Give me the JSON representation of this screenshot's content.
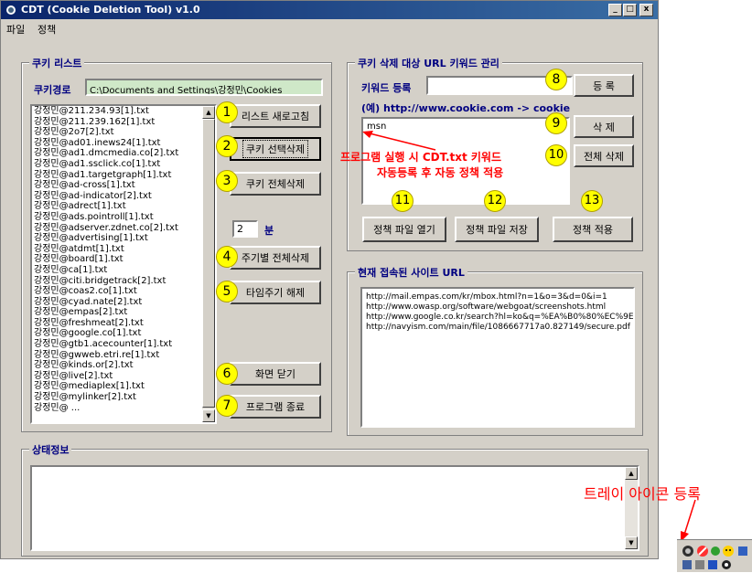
{
  "window": {
    "title": "CDT (Cookie Deletion Tool) v1.0",
    "minimize": "_",
    "maximize": "□",
    "close": "x"
  },
  "menu": [
    "파일",
    "정책"
  ],
  "cookie_list": {
    "group_label": "쿠키 리스트",
    "path_label": "쿠키경로",
    "path_value": "C:\\Documents and Settings\\강정민\\Cookies",
    "items": [
      "강정민@211.234.93[1].txt",
      "강정민@211.239.162[1].txt",
      "강정민@2o7[2].txt",
      "강정민@ad01.inews24[1].txt",
      "강정민@ad1.dmcmedia.co[2].txt",
      "강정민@ad1.ssclick.co[1].txt",
      "강정민@ad1.targetgraph[1].txt",
      "강정민@ad-cross[1].txt",
      "강정민@ad-indicator[2].txt",
      "강정민@adrect[1].txt",
      "강정민@ads.pointroll[1].txt",
      "강정민@adserver.zdnet.co[2].txt",
      "강정민@advertising[1].txt",
      "강정민@atdmt[1].txt",
      "강정민@board[1].txt",
      "강정민@ca[1].txt",
      "강정민@citi.bridgetrack[2].txt",
      "강정민@coas2.co[1].txt",
      "강정민@cyad.nate[2].txt",
      "강정민@empas[2].txt",
      "강정민@freshmeat[2].txt",
      "강정민@google.co[1].txt",
      "강정민@gtb1.acecounter[1].txt",
      "강정민@gwweb.etri.re[1].txt",
      "강정민@kinds.or[2].txt",
      "강정민@live[2].txt",
      "강정민@mediaplex[1].txt",
      "강정민@mylinker[2].txt",
      "강정민@ ..."
    ],
    "buttons": {
      "refresh": "리스트 새로고침",
      "delete_selected": "쿠키 선택삭제",
      "delete_all": "쿠키 전체삭제",
      "periodic_delete": "주기별 전체삭제",
      "cancel_timer": "타임주기 해제",
      "close_screen": "화면 닫기",
      "exit": "프로그램 종료"
    },
    "minutes_value": "2",
    "minutes_unit": "분"
  },
  "badges": [
    "1",
    "2",
    "3",
    "4",
    "5",
    "6",
    "7",
    "8",
    "9",
    "10",
    "11",
    "12",
    "13"
  ],
  "keyword_mgmt": {
    "group_label": "쿠키 삭제 대상 URL 키워드 관리",
    "keyword_label": "키워드 등록",
    "keyword_value": "",
    "register_button": "등 록",
    "example": "(예) http://www.cookie.com -> cookie",
    "keywords": [
      "msn"
    ],
    "delete_button": "삭 제",
    "delete_all_button": "전체 삭제",
    "note_line1": "프로그램 실행 시 CDT.txt 키워드",
    "note_line2": "자동등록 후 자동 정책 적용",
    "open_policy": "정책 파일 열기",
    "save_policy": "정책 파일 저장",
    "apply_policy": "정책 적용"
  },
  "current_sites": {
    "group_label": "현재 접속된 사이트 URL",
    "urls": [
      "http://mail.empas.com/kr/mbox.html?n=1&o=3&d=0&i=1",
      "http://www.owasp.org/software/webgoat/screenshots.html",
      "http://www.google.co.kr/search?hl=ko&q=%EA%B0%80%EC%9E%",
      "http://navyism.com/main/file/1086667717a0.827149/secure.pdf"
    ]
  },
  "status": {
    "group_label": "상태정보",
    "text": ""
  },
  "tray": {
    "annotation": "트레이 아이콘 등록"
  },
  "colors": {
    "face": "#d4d0c8",
    "title_start": "#0a246a",
    "title_end": "#3a6ea5",
    "label_blue": "#000080",
    "badge_yellow": "#ffff00",
    "note_red": "#ff0000",
    "path_field": "#cfe8c8"
  }
}
